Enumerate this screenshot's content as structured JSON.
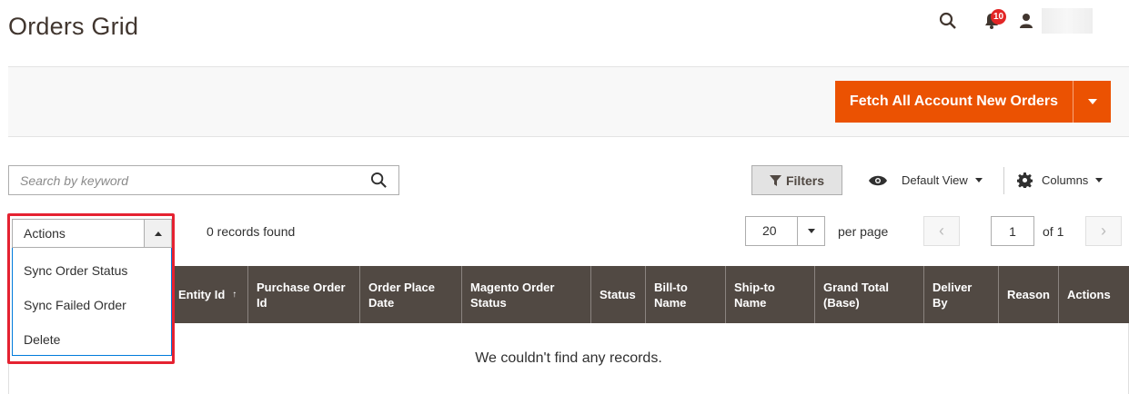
{
  "page": {
    "title": "Orders Grid"
  },
  "header": {
    "notification_count": "10"
  },
  "action_bar": {
    "fetch_button_label": "Fetch All Account New Orders"
  },
  "toolbar": {
    "search_placeholder": "Search by keyword",
    "filters_label": "Filters",
    "view_label": "Default View",
    "columns_label": "Columns"
  },
  "mass_actions": {
    "selected_label": "Actions",
    "options": [
      "Sync Order Status",
      "Sync Failed Order",
      "Delete"
    ]
  },
  "records_found": "0 records found",
  "pagination": {
    "per_page_value": "20",
    "per_page_label": "per page",
    "current_page": "1",
    "of_label": "of 1"
  },
  "grid": {
    "columns": [
      "Entity Id",
      "Purchase Order Id",
      "Order Place Date",
      "Magento Order Status",
      "Status",
      "Bill-to Name",
      "Ship-to Name",
      "Grand Total (Base)",
      "Deliver By",
      "Reason",
      "Actions"
    ],
    "empty_message": "We couldn't find any records."
  },
  "colors": {
    "accent": "#eb5202",
    "header_bg": "#514943",
    "highlight": "#e52231"
  }
}
